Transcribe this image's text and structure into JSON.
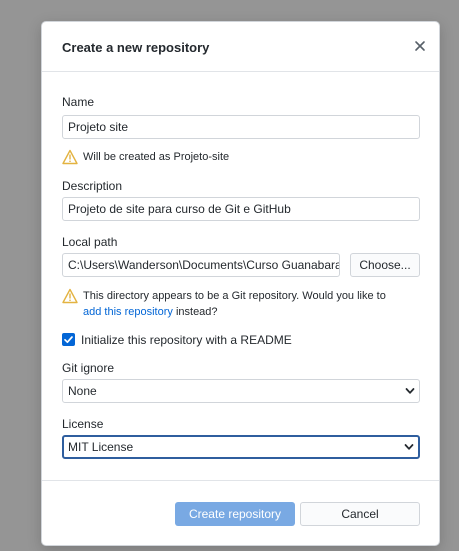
{
  "dialog": {
    "title": "Create a new repository",
    "close_icon": "close-icon"
  },
  "name": {
    "label": "Name",
    "value": "Projeto site",
    "warning": "Will be created as Projeto-site"
  },
  "description": {
    "label": "Description",
    "value": "Projeto de site para curso de Git e GitHub"
  },
  "local_path": {
    "label": "Local path",
    "value": "C:\\Users\\Wanderson\\Documents\\Curso Guanabara",
    "choose_label": "Choose...",
    "warning_line1": "This directory appears to be a Git repository. Would you like to",
    "warning_link": "add this repository",
    "warning_line2_suffix": " instead?"
  },
  "readme": {
    "checked": true,
    "label": "Initialize this repository with a README"
  },
  "git_ignore": {
    "label": "Git ignore",
    "selected": "None"
  },
  "license": {
    "label": "License",
    "selected": "MIT License"
  },
  "footer": {
    "create_label": "Create repository",
    "cancel_label": "Cancel"
  },
  "colors": {
    "accent": "#0366d6",
    "primary_button": "#79a9e3",
    "warning": "#f2c744",
    "overlay": "#959595"
  }
}
